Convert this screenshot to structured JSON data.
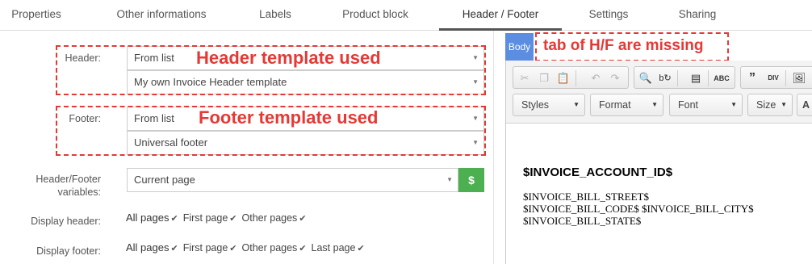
{
  "tabs": [
    {
      "label": "Properties"
    },
    {
      "label": "Other informations"
    },
    {
      "label": "Labels"
    },
    {
      "label": "Product block"
    },
    {
      "label": "Header / Footer",
      "active": true
    },
    {
      "label": "Settings"
    },
    {
      "label": "Sharing"
    }
  ],
  "form": {
    "header": {
      "label": "Header:",
      "mode": "From list",
      "template": "My own Invoice Header template"
    },
    "footer": {
      "label": "Footer:",
      "mode": "From list",
      "template": "Universal footer"
    },
    "variables": {
      "label_line1": "Header/Footer",
      "label_line2": "variables:",
      "value": "Current page",
      "button": "$"
    },
    "display_header": {
      "label": "Display header:",
      "all": "All pages",
      "options": [
        "First page",
        "Other pages"
      ]
    },
    "display_footer": {
      "label": "Display footer:",
      "all": "All pages",
      "options": [
        "First page",
        "Other pages",
        "Last page"
      ]
    }
  },
  "annotations": {
    "header": "Header template used",
    "footer": "Footer template used",
    "missing_tabs": "tab of H/F are missing"
  },
  "editor": {
    "body_tab": "Body",
    "combos": {
      "styles": "Styles",
      "format": "Format",
      "font": "Font",
      "size": "Size"
    },
    "content": {
      "heading": "$INVOICE_ACCOUNT_ID$",
      "lines": [
        "$INVOICE_BILL_STREET$",
        "$INVOICE_BILL_CODE$ $INVOICE_BILL_CITY$",
        "$INVOICE_BILL_STATE$"
      ]
    }
  },
  "colors": {
    "annotation": "#e53935",
    "body_tab": "#5b8de1",
    "dollar_button": "#4caf50"
  }
}
